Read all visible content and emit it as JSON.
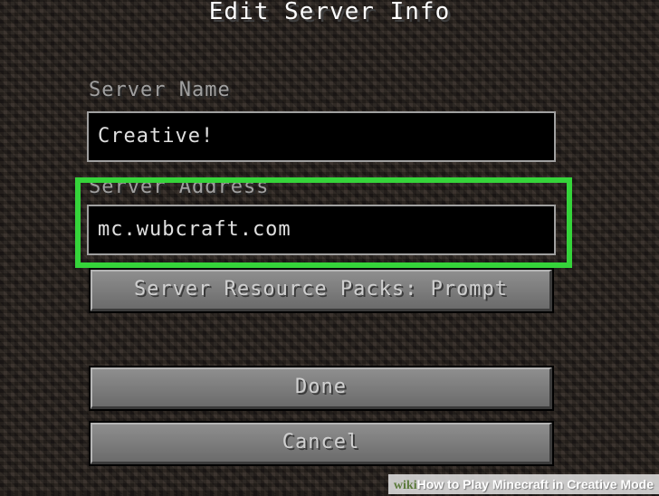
{
  "screen": {
    "title": "Edit Server Info"
  },
  "fields": {
    "server_name": {
      "label": "Server Name",
      "value": "Creative!"
    },
    "server_address": {
      "label": "Server Address",
      "value": "mc.wubcraft.com"
    }
  },
  "buttons": {
    "resource_packs": "Server Resource Packs: Prompt",
    "done": "Done",
    "cancel": "Cancel"
  },
  "watermark": {
    "brand": "wiki",
    "how": "How",
    "text": " to Play Minecraft in Creative Mode"
  },
  "colors": {
    "highlight": "#35d43a",
    "label": "#a0a0a0",
    "button_face": "#7d7d7d"
  }
}
